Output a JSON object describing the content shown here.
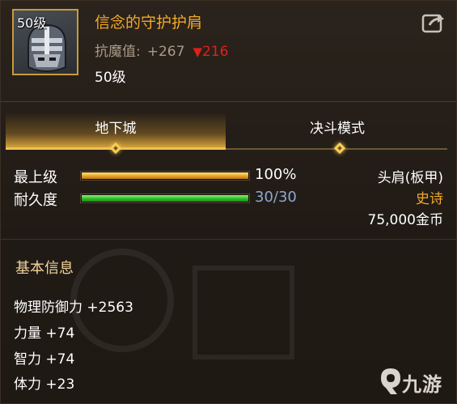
{
  "item": {
    "level_badge": "50级",
    "name": "信念的守护护肩",
    "stat_label": "抗魔值:",
    "stat_value": "+267",
    "stat_diff": "216",
    "level_text": "50级"
  },
  "tabs": [
    {
      "label": "地下城",
      "active": true
    },
    {
      "label": "决斗模式",
      "active": false
    }
  ],
  "bars": {
    "max_level": {
      "label": "最上级",
      "value_text": "100%",
      "fraction": 1.0
    },
    "durability": {
      "label": "耐久度",
      "value_text": "30/30",
      "fraction": 1.0
    }
  },
  "info": {
    "slot": "头肩(板甲)",
    "rarity": "史诗",
    "price": "75,000金币"
  },
  "basic": {
    "title": "基本信息",
    "attrs": [
      "物理防御力 +2563",
      "力量 +74",
      "智力 +74",
      "体力 +23"
    ]
  },
  "watermark": {
    "text": "九游"
  },
  "colors": {
    "name_orange": "#f3a928",
    "diff_red": "#e0201b",
    "rarity_orange": "#f3a928",
    "durability_blue": "#8fa8d0",
    "tab_gold": "#d8a53a"
  },
  "icons": [
    "helmet-icon",
    "share-icon",
    "down-arrow-icon",
    "diamond-marker-icon",
    "jiuyou-logo-icon"
  ]
}
